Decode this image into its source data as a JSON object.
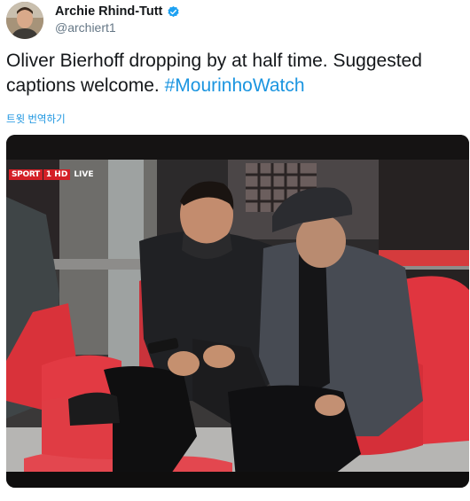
{
  "tweet": {
    "author": {
      "display_name": "Archie Rhind-Tutt",
      "handle": "@archiert1",
      "verified": true
    },
    "text_main": "Oliver Bierhoff dropping by at half time. Suggested captions welcome. ",
    "hashtag": "#MourinhoWatch",
    "translate_label": "트윗 번역하기",
    "media": {
      "broadcast_logo": "SPORT",
      "broadcast_channel": "1 HD",
      "broadcast_live": "LIVE"
    }
  },
  "colors": {
    "link": "#1b95e0",
    "text": "#14171a",
    "secondary": "#657786",
    "verified": "#1da1f2"
  },
  "icons": {
    "verified": "verified-badge-icon"
  }
}
